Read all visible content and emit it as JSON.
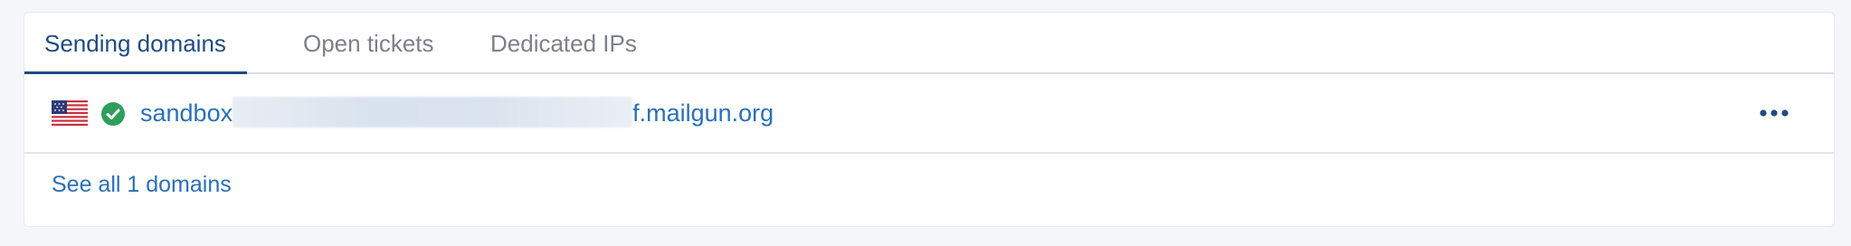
{
  "tabs": [
    {
      "label": "Sending domains",
      "active": true
    },
    {
      "label": "Open tickets",
      "active": false
    },
    {
      "label": "Dedicated IPs",
      "active": false
    }
  ],
  "domain_row": {
    "flag_icon": "us-flag-icon",
    "status_icon": "check-circle-icon",
    "status_color": "#2e9e5b",
    "domain_prefix": "sandbox",
    "domain_suffix": "f.mailgun.org",
    "menu_icon": "more-horizontal-icon"
  },
  "see_all_label": "See all 1 domains",
  "colors": {
    "accent": "#1f4b82",
    "link": "#2a70b7"
  }
}
